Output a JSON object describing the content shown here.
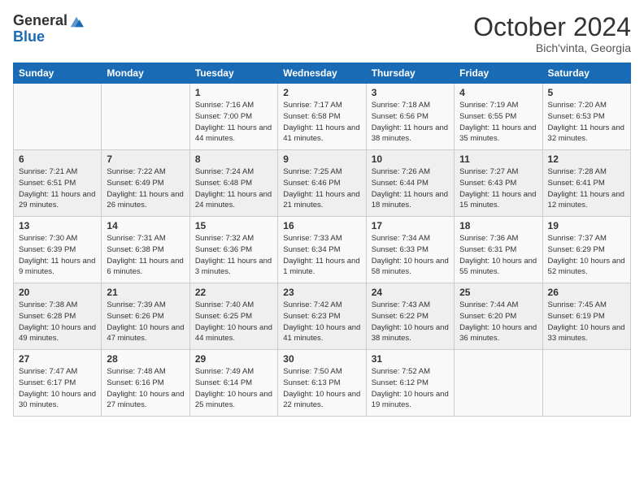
{
  "header": {
    "logo_general": "General",
    "logo_blue": "Blue",
    "month_title": "October 2024",
    "subtitle": "Bich'vinta, Georgia"
  },
  "weekdays": [
    "Sunday",
    "Monday",
    "Tuesday",
    "Wednesday",
    "Thursday",
    "Friday",
    "Saturday"
  ],
  "weeks": [
    [
      {
        "day": "",
        "sunrise": "",
        "sunset": "",
        "daylight": ""
      },
      {
        "day": "",
        "sunrise": "",
        "sunset": "",
        "daylight": ""
      },
      {
        "day": "1",
        "sunrise": "Sunrise: 7:16 AM",
        "sunset": "Sunset: 7:00 PM",
        "daylight": "Daylight: 11 hours and 44 minutes."
      },
      {
        "day": "2",
        "sunrise": "Sunrise: 7:17 AM",
        "sunset": "Sunset: 6:58 PM",
        "daylight": "Daylight: 11 hours and 41 minutes."
      },
      {
        "day": "3",
        "sunrise": "Sunrise: 7:18 AM",
        "sunset": "Sunset: 6:56 PM",
        "daylight": "Daylight: 11 hours and 38 minutes."
      },
      {
        "day": "4",
        "sunrise": "Sunrise: 7:19 AM",
        "sunset": "Sunset: 6:55 PM",
        "daylight": "Daylight: 11 hours and 35 minutes."
      },
      {
        "day": "5",
        "sunrise": "Sunrise: 7:20 AM",
        "sunset": "Sunset: 6:53 PM",
        "daylight": "Daylight: 11 hours and 32 minutes."
      }
    ],
    [
      {
        "day": "6",
        "sunrise": "Sunrise: 7:21 AM",
        "sunset": "Sunset: 6:51 PM",
        "daylight": "Daylight: 11 hours and 29 minutes."
      },
      {
        "day": "7",
        "sunrise": "Sunrise: 7:22 AM",
        "sunset": "Sunset: 6:49 PM",
        "daylight": "Daylight: 11 hours and 26 minutes."
      },
      {
        "day": "8",
        "sunrise": "Sunrise: 7:24 AM",
        "sunset": "Sunset: 6:48 PM",
        "daylight": "Daylight: 11 hours and 24 minutes."
      },
      {
        "day": "9",
        "sunrise": "Sunrise: 7:25 AM",
        "sunset": "Sunset: 6:46 PM",
        "daylight": "Daylight: 11 hours and 21 minutes."
      },
      {
        "day": "10",
        "sunrise": "Sunrise: 7:26 AM",
        "sunset": "Sunset: 6:44 PM",
        "daylight": "Daylight: 11 hours and 18 minutes."
      },
      {
        "day": "11",
        "sunrise": "Sunrise: 7:27 AM",
        "sunset": "Sunset: 6:43 PM",
        "daylight": "Daylight: 11 hours and 15 minutes."
      },
      {
        "day": "12",
        "sunrise": "Sunrise: 7:28 AM",
        "sunset": "Sunset: 6:41 PM",
        "daylight": "Daylight: 11 hours and 12 minutes."
      }
    ],
    [
      {
        "day": "13",
        "sunrise": "Sunrise: 7:30 AM",
        "sunset": "Sunset: 6:39 PM",
        "daylight": "Daylight: 11 hours and 9 minutes."
      },
      {
        "day": "14",
        "sunrise": "Sunrise: 7:31 AM",
        "sunset": "Sunset: 6:38 PM",
        "daylight": "Daylight: 11 hours and 6 minutes."
      },
      {
        "day": "15",
        "sunrise": "Sunrise: 7:32 AM",
        "sunset": "Sunset: 6:36 PM",
        "daylight": "Daylight: 11 hours and 3 minutes."
      },
      {
        "day": "16",
        "sunrise": "Sunrise: 7:33 AM",
        "sunset": "Sunset: 6:34 PM",
        "daylight": "Daylight: 11 hours and 1 minute."
      },
      {
        "day": "17",
        "sunrise": "Sunrise: 7:34 AM",
        "sunset": "Sunset: 6:33 PM",
        "daylight": "Daylight: 10 hours and 58 minutes."
      },
      {
        "day": "18",
        "sunrise": "Sunrise: 7:36 AM",
        "sunset": "Sunset: 6:31 PM",
        "daylight": "Daylight: 10 hours and 55 minutes."
      },
      {
        "day": "19",
        "sunrise": "Sunrise: 7:37 AM",
        "sunset": "Sunset: 6:29 PM",
        "daylight": "Daylight: 10 hours and 52 minutes."
      }
    ],
    [
      {
        "day": "20",
        "sunrise": "Sunrise: 7:38 AM",
        "sunset": "Sunset: 6:28 PM",
        "daylight": "Daylight: 10 hours and 49 minutes."
      },
      {
        "day": "21",
        "sunrise": "Sunrise: 7:39 AM",
        "sunset": "Sunset: 6:26 PM",
        "daylight": "Daylight: 10 hours and 47 minutes."
      },
      {
        "day": "22",
        "sunrise": "Sunrise: 7:40 AM",
        "sunset": "Sunset: 6:25 PM",
        "daylight": "Daylight: 10 hours and 44 minutes."
      },
      {
        "day": "23",
        "sunrise": "Sunrise: 7:42 AM",
        "sunset": "Sunset: 6:23 PM",
        "daylight": "Daylight: 10 hours and 41 minutes."
      },
      {
        "day": "24",
        "sunrise": "Sunrise: 7:43 AM",
        "sunset": "Sunset: 6:22 PM",
        "daylight": "Daylight: 10 hours and 38 minutes."
      },
      {
        "day": "25",
        "sunrise": "Sunrise: 7:44 AM",
        "sunset": "Sunset: 6:20 PM",
        "daylight": "Daylight: 10 hours and 36 minutes."
      },
      {
        "day": "26",
        "sunrise": "Sunrise: 7:45 AM",
        "sunset": "Sunset: 6:19 PM",
        "daylight": "Daylight: 10 hours and 33 minutes."
      }
    ],
    [
      {
        "day": "27",
        "sunrise": "Sunrise: 7:47 AM",
        "sunset": "Sunset: 6:17 PM",
        "daylight": "Daylight: 10 hours and 30 minutes."
      },
      {
        "day": "28",
        "sunrise": "Sunrise: 7:48 AM",
        "sunset": "Sunset: 6:16 PM",
        "daylight": "Daylight: 10 hours and 27 minutes."
      },
      {
        "day": "29",
        "sunrise": "Sunrise: 7:49 AM",
        "sunset": "Sunset: 6:14 PM",
        "daylight": "Daylight: 10 hours and 25 minutes."
      },
      {
        "day": "30",
        "sunrise": "Sunrise: 7:50 AM",
        "sunset": "Sunset: 6:13 PM",
        "daylight": "Daylight: 10 hours and 22 minutes."
      },
      {
        "day": "31",
        "sunrise": "Sunrise: 7:52 AM",
        "sunset": "Sunset: 6:12 PM",
        "daylight": "Daylight: 10 hours and 19 minutes."
      },
      {
        "day": "",
        "sunrise": "",
        "sunset": "",
        "daylight": ""
      },
      {
        "day": "",
        "sunrise": "",
        "sunset": "",
        "daylight": ""
      }
    ]
  ]
}
